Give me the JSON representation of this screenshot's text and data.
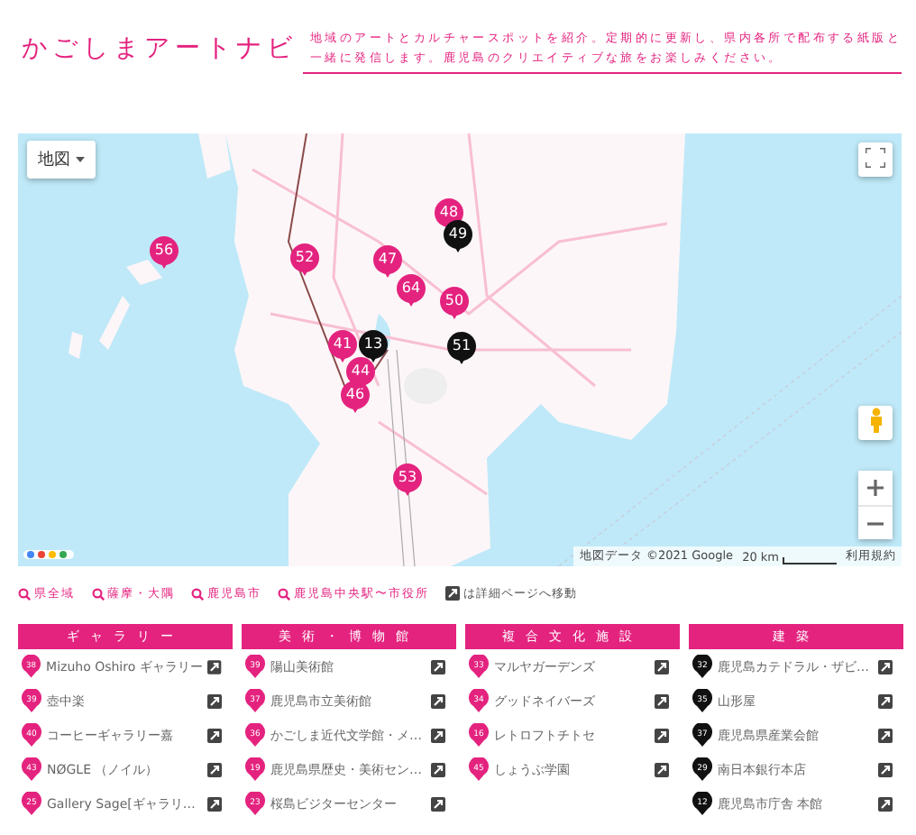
{
  "site": {
    "title": "かごしまアートナビ",
    "description": "地域のアートとカルチャースポットを紹介。定期的に更新し、県内各所で配布する紙版と一緒に発信します。鹿児島のクリエイティブな旅をお楽しみください。"
  },
  "map": {
    "type_control": "地図",
    "attribution": "地図データ ©2021 Google",
    "scale": "20 km",
    "terms": "利用規約",
    "markers": [
      {
        "label": "56",
        "kind": "art"
      },
      {
        "label": "52",
        "kind": "art"
      },
      {
        "label": "47",
        "kind": "art"
      },
      {
        "label": "48",
        "kind": "art"
      },
      {
        "label": "49",
        "kind": "architecture"
      },
      {
        "label": "64",
        "kind": "art"
      },
      {
        "label": "50",
        "kind": "art"
      },
      {
        "label": "41",
        "kind": "art"
      },
      {
        "label": "46",
        "kind": "art"
      },
      {
        "label": "44",
        "kind": "art"
      },
      {
        "label": "13",
        "kind": "architecture"
      },
      {
        "label": "51",
        "kind": "architecture"
      },
      {
        "label": "53",
        "kind": "art"
      }
    ]
  },
  "area_links": [
    "県全域",
    "薩摩・大隅",
    "鹿児島市",
    "鹿児島中央駅〜市役所"
  ],
  "legend": "は詳細ページへ移動",
  "categories": [
    {
      "title": "ギャラリー",
      "items": [
        {
          "number": "38",
          "name": "Mizuho Oshiro ギャラリー",
          "kind": "art"
        },
        {
          "number": "39",
          "name": "壺中楽",
          "kind": "art"
        },
        {
          "number": "40",
          "name": "コーヒーギャラリー嘉",
          "kind": "art"
        },
        {
          "number": "43",
          "name": "NØGLE （ノイル）",
          "kind": "art"
        },
        {
          "number": "25",
          "name": "Gallery Sage[ギャラリ…",
          "kind": "art"
        }
      ]
    },
    {
      "title": "美術・博物館",
      "items": [
        {
          "number": "39",
          "name": "陽山美術館",
          "kind": "art"
        },
        {
          "number": "37",
          "name": "鹿児島市立美術館",
          "kind": "art"
        },
        {
          "number": "36",
          "name": "かごしま近代文学館・メ…",
          "kind": "art"
        },
        {
          "number": "19",
          "name": "鹿児島県歴史・美術セン…",
          "kind": "art"
        },
        {
          "number": "23",
          "name": "桜島ビジターセンター",
          "kind": "art"
        }
      ]
    },
    {
      "title": "複合文化施設",
      "items": [
        {
          "number": "33",
          "name": "マルヤガーデンズ",
          "kind": "art"
        },
        {
          "number": "34",
          "name": "グッドネイバーズ",
          "kind": "art"
        },
        {
          "number": "16",
          "name": "レトロフトチトセ",
          "kind": "art"
        },
        {
          "number": "45",
          "name": "しょうぶ学園",
          "kind": "art"
        }
      ]
    },
    {
      "title": "建築",
      "items": [
        {
          "number": "32",
          "name": "鹿児島カテドラル・ザビ…",
          "kind": "architecture"
        },
        {
          "number": "35",
          "name": "山形屋",
          "kind": "architecture"
        },
        {
          "number": "37",
          "name": "鹿児島県産業会館",
          "kind": "architecture"
        },
        {
          "number": "29",
          "name": "南日本銀行本店",
          "kind": "architecture"
        },
        {
          "number": "12",
          "name": "鹿児島市庁舎 本館",
          "kind": "architecture"
        }
      ]
    }
  ]
}
